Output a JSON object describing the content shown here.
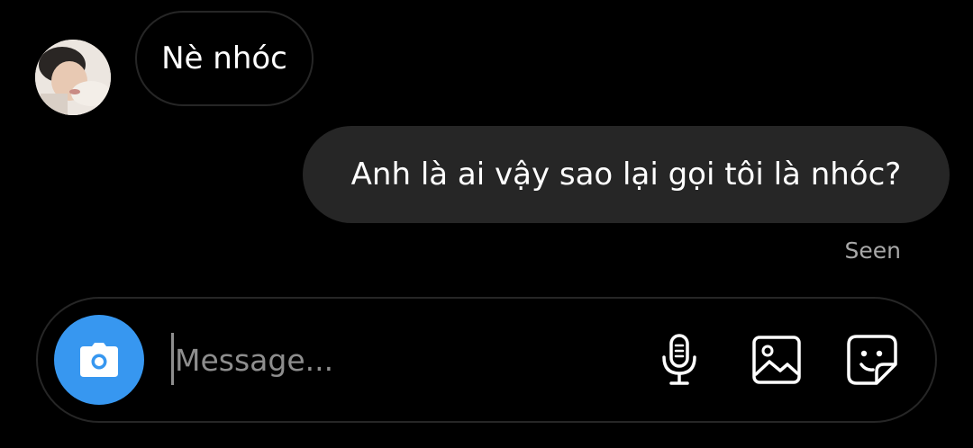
{
  "thread": {
    "messages": [
      {
        "direction": "incoming",
        "text": "Nè nhóc"
      },
      {
        "direction": "outgoing",
        "text": "Anh là ai vậy sao lại gọi tôi là nhóc?"
      }
    ],
    "status": "Seen"
  },
  "composer": {
    "placeholder": "Message...",
    "value": "",
    "icons": {
      "camera": "camera-icon",
      "mic": "microphone-icon",
      "gallery": "image-icon",
      "sticker": "sticker-icon"
    }
  },
  "colors": {
    "background": "#000000",
    "outgoing_bubble": "#262626",
    "incoming_bubble_border": "#262626",
    "accent_blue": "#3797f0",
    "seen_text": "#a8a8a8",
    "placeholder_text": "#8e8e8e"
  }
}
